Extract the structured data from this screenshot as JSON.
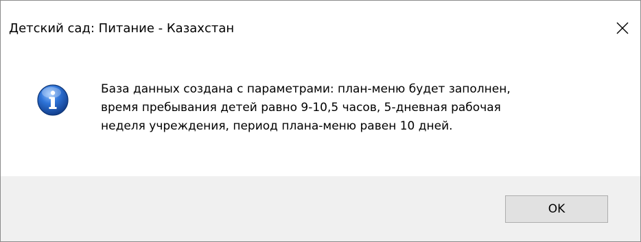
{
  "window": {
    "title": "Детский сад: Питание - Казахстан",
    "close_icon": "close-icon"
  },
  "message": {
    "icon": "info-icon",
    "lines": [
      "База данных создана с параметрами: план-меню будет заполнен,",
      "время пребывания детей равно 9-10,5 часов, 5-дневная рабочая",
      "неделя учреждения, период плана-меню равен 10 дней."
    ]
  },
  "buttons": {
    "ok_label": "OK"
  },
  "colors": {
    "footer_bg": "#f0f0f0",
    "button_bg": "#e1e1e1",
    "button_border": "#adadad",
    "icon_blue": "#1f5fbf"
  }
}
